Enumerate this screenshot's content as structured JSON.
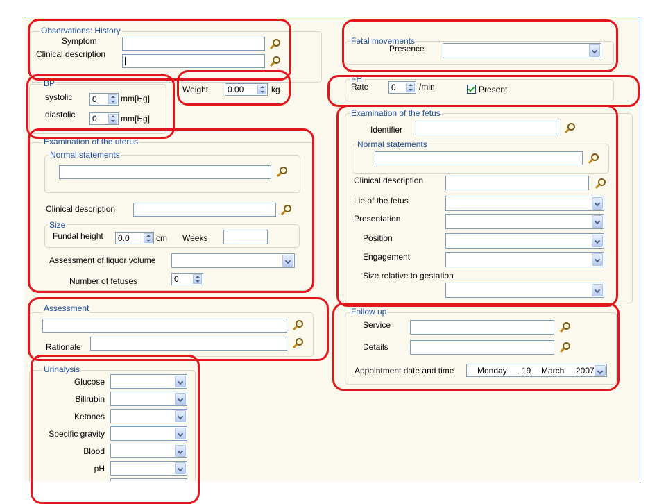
{
  "observations_history": {
    "legend": "Observations: History",
    "symptom_label": "Symptom",
    "clinical_description_label": "Clinical description",
    "symptom_value": "",
    "clinical_description_value": ""
  },
  "bp": {
    "legend": "BP",
    "systolic_label": "systolic",
    "systolic_value": "0",
    "diastolic_label": "diastolic",
    "diastolic_value": "0",
    "unit": "mm[Hg]"
  },
  "weight": {
    "label": "Weight",
    "value": "0.00",
    "unit": "kg"
  },
  "fetal_movements": {
    "legend": "Fetal movements",
    "presence_label": "Presence",
    "presence_value": ""
  },
  "fh": {
    "legend": "FH",
    "rate_label": "Rate",
    "rate_value": "0",
    "rate_unit": "/min",
    "present_label": "Present",
    "present_checked": true
  },
  "uterus": {
    "legend": "Examination of the uterus",
    "normal_statements_legend": "Normal statements",
    "normal_statements_value": "",
    "clinical_description_label": "Clinical description",
    "size_legend": "Size",
    "fundal_height_label": "Fundal height",
    "fundal_height_value": "0.0",
    "fundal_height_unit": "cm",
    "weeks_label": "Weeks",
    "weeks_value": "",
    "liquor_label": "Assessment of liquor volume",
    "liquor_value": "",
    "fetuses_label": "Number of fetuses",
    "fetuses_value": "0"
  },
  "fetus": {
    "legend": "Examination of the fetus",
    "identifier_label": "Identifier",
    "normal_statements_legend": "Normal statements",
    "clinical_description_label": "Clinical description",
    "lie_label": "Lie of the fetus",
    "presentation_label": "Presentation",
    "position_label": "Position",
    "engagement_label": "Engagement",
    "size_label": "Size relative to gestation"
  },
  "assessment": {
    "legend": "Assessment",
    "rationale_label": "Rationale"
  },
  "follow_up": {
    "legend": "Follow up",
    "service_label": "Service",
    "details_label": "Details",
    "appointment_label": "Appointment date and time",
    "date_day": "Monday",
    "date_sep": ",",
    "date_num": "19",
    "date_month": "March",
    "date_year": "2007"
  },
  "urinalysis": {
    "legend": "Urinalysis",
    "items": [
      {
        "label": "Glucose"
      },
      {
        "label": "Bilirubin"
      },
      {
        "label": "Ketones"
      },
      {
        "label": "Specific gravity"
      },
      {
        "label": "Blood"
      },
      {
        "label": "pH"
      }
    ]
  },
  "colors": {
    "highlight": "#e2161d",
    "legend_text": "#1d4ea3",
    "form_bg": "#fbf8ee"
  }
}
